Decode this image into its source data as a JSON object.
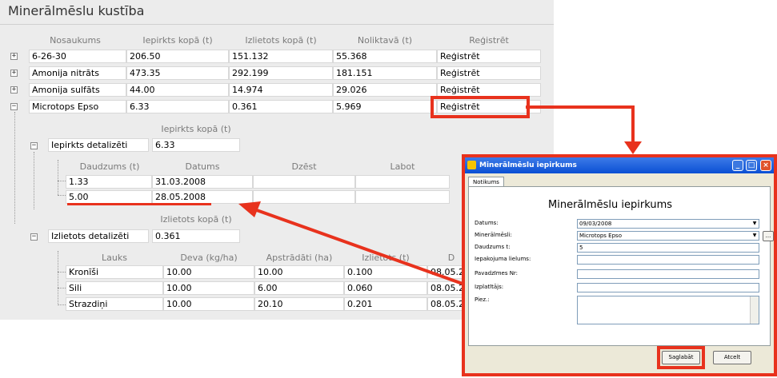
{
  "main": {
    "title": "Minerālmēslu kustība",
    "headers": [
      "Nosaukums",
      "Iepirkts kopā (t)",
      "Izlietots kopā (t)",
      "Noliktavā (t)",
      "Reģistrēt"
    ],
    "rows": [
      {
        "expander": "+",
        "name": "6-26-30",
        "bought": "206.50",
        "used": "151.132",
        "stock": "55.368",
        "action": "Reģistrēt"
      },
      {
        "expander": "+",
        "name": "Amonija nitrāts",
        "bought": "473.35",
        "used": "292.199",
        "stock": "181.151",
        "action": "Reģistrēt"
      },
      {
        "expander": "+",
        "name": "Amonija sulfāts",
        "bought": "44.00",
        "used": "14.974",
        "stock": "29.026",
        "action": "Reģistrēt"
      },
      {
        "expander": "−",
        "name": "Microtops Epso",
        "bought": "6.33",
        "used": "0.361",
        "stock": "5.969",
        "action": "Reģistrēt"
      }
    ],
    "purchase": {
      "total_header": "Iepirkts kopā (t)",
      "expander": "−",
      "label": "Iepirkts detalizēti",
      "total": "6.33",
      "headers": [
        "Daudzums (t)",
        "Datums",
        "Dzēst",
        "Labot"
      ],
      "rows": [
        {
          "qty": "1.33",
          "date": "31.03.2008"
        },
        {
          "qty": "5.00",
          "date": "28.05.2008"
        }
      ]
    },
    "usage": {
      "total_header": "Izlietots kopā (t)",
      "expander": "−",
      "label": "Izlietots detalizēti",
      "total": "0.361",
      "headers": [
        "Lauks",
        "Deva (kg/ha)",
        "Apstrādāti (ha)",
        "Izlietots (t)",
        "D"
      ],
      "rows": [
        {
          "field": "Kronīši",
          "dose": "10.00",
          "area": "10.00",
          "used": "0.100",
          "date": "08.05.2"
        },
        {
          "field": "Sili",
          "dose": "10.00",
          "area": "6.00",
          "used": "0.060",
          "date": "08.05.2"
        },
        {
          "field": "Strazdiņi",
          "dose": "10.00",
          "area": "20.10",
          "used": "0.201",
          "date": "08.05.2"
        }
      ]
    }
  },
  "dialog": {
    "title": "Minerālmēslu iepirkums",
    "tab": "Notikums",
    "heading": "Minerālmēslu iepirkums",
    "fields": [
      {
        "label": "Datums:",
        "value": "09/03/2008",
        "dropdown": "▼"
      },
      {
        "label": "Minerālmēsli:",
        "value": "Microtops Epso",
        "dropdown": "▼"
      },
      {
        "label": "Daudzums t:",
        "value": "5"
      },
      {
        "label": "Iepakojuma lielums:",
        "value": ""
      },
      {
        "label": "Pavadzīmes Nr:",
        "value": ""
      },
      {
        "label": "Izplatītājs:",
        "value": ""
      },
      {
        "label": "Piez.:",
        "value": ""
      }
    ],
    "browse_label": "...",
    "save_label": "Saglabāt",
    "cancel_label": "Atcelt",
    "window_buttons": [
      "_",
      "□",
      "×"
    ]
  },
  "colors": {
    "annotation": "#e8321d",
    "titlebar": "#0a4fd4"
  }
}
